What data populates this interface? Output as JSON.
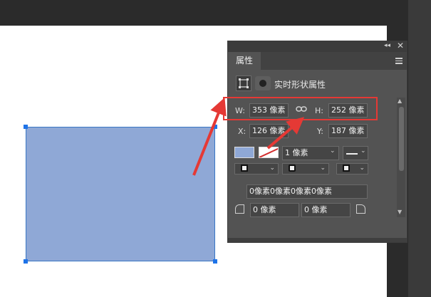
{
  "panel": {
    "tab_label": "属性",
    "collapse_glyph": "◂◂",
    "close_glyph": "✕",
    "section_title": "实时形状属性",
    "width_label": "W:",
    "width_value": "353 像素",
    "height_label": "H:",
    "height_value": "252 像素",
    "x_label": "X:",
    "x_value": "126 像素",
    "y_label": "Y:",
    "y_value": "187 像素",
    "stroke_width_value": "1 像素",
    "corner_radius_all": "0像素0像素0像素0像素",
    "corner_radius_tl": "0 像素",
    "corner_radius_tr": "0 像素"
  },
  "colors": {
    "shape_fill": "#8fa8d6",
    "shape_border": "#3a76c4",
    "annotation": "#e53935",
    "panel_bg": "#535353"
  },
  "icons": [
    "link-icon",
    "menu-icon",
    "close-icon",
    "collapse-icon",
    "shape-mode-icon",
    "mask-icon",
    "corner-tl-icon",
    "corner-tr-icon"
  ]
}
